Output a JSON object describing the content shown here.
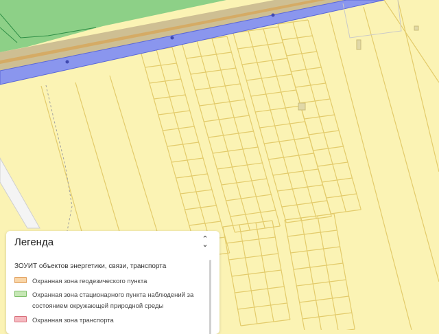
{
  "legend": {
    "title": "Легенда",
    "section_title": "ЗОУИТ объектов энергетики, связи, транспорта",
    "items": [
      {
        "label": "Охранная зона геодезического пункта",
        "color": "#f9d6a8",
        "border": "#e0a060"
      },
      {
        "label": "Охранная зона стационарного пункта наблюдений за состоянием окружающей природной среды",
        "label_line1": "Охранная зона стационарного пункта наблюдений за",
        "label_line2": "состоянием окружающей природной среды",
        "color": "#c6e7b5",
        "border": "#7fbf6a"
      },
      {
        "label": "Охранная зона транспорта",
        "color": "#f5b9c0",
        "border": "#d9707c"
      }
    ]
  },
  "map": {
    "colors": {
      "background": "#fbf3b4",
      "parcel_line": "#e3cb6b",
      "road": "#8a96ee",
      "road_border": "#5a67d8",
      "forest": "#79c97f",
      "forest_dark": "#2f8f46",
      "path": "#a0a0a0"
    }
  }
}
